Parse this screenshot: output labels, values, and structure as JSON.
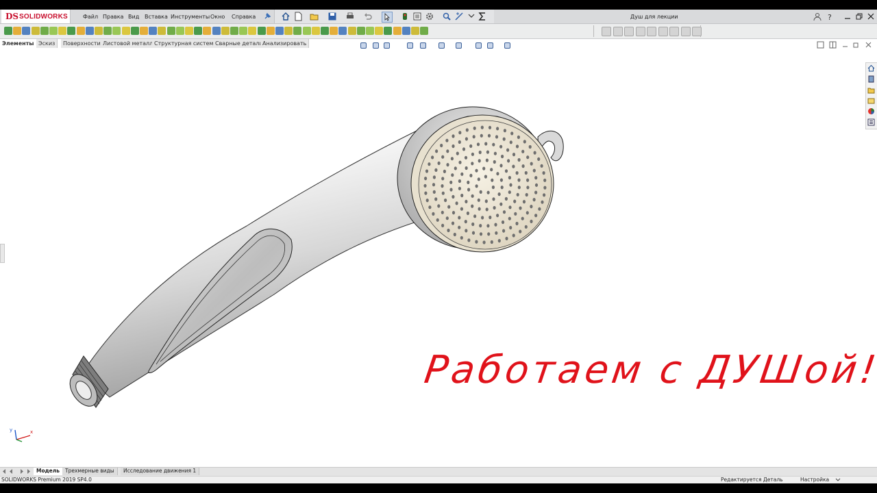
{
  "app": {
    "logo_ds": "DS",
    "logo_text": "SOLIDWORKS",
    "document_title": "Душ для лекции"
  },
  "menu": [
    "Файл",
    "Правка",
    "Вид",
    "Вставка",
    "Инструменты",
    "Окно",
    "Справка"
  ],
  "tabs": [
    "Элементы",
    "Эскиз",
    "Поверхности",
    "Листовой металл",
    "Структурная система",
    "Сварные детали",
    "Анализировать"
  ],
  "bottom_tabs": [
    "Модель",
    "Трехмерные виды",
    "Исследование движения 1"
  ],
  "status": {
    "version": "SOLIDWORKS Premium 2019 SP4.0",
    "editing": "Редактируется Деталь",
    "custom": "Настройка"
  },
  "overlay_text": "Работаем с ДУШой!",
  "triad": {
    "x": "x",
    "y": "y"
  },
  "colors": {
    "brand": "#c8102e",
    "overlay": "#e0121a",
    "model_body": "#d8d8d8",
    "shower_face": "#efe9dc"
  },
  "icons": {
    "toolbar": [
      "home-icon",
      "new-document-icon",
      "open-icon",
      "save-icon",
      "print-icon",
      "undo-icon",
      "select-icon",
      "rebuild-icon",
      "file-properties-icon",
      "options-icon",
      "zoom-icon",
      "measure-icon",
      "sum-icon"
    ],
    "window": [
      "user-icon",
      "help-icon",
      "minimize-icon",
      "restore-icon",
      "close-icon"
    ],
    "taskpane": [
      "home-icon",
      "resources-icon",
      "library-icon",
      "explorer-icon",
      "appearance-icon",
      "properties-icon"
    ]
  }
}
